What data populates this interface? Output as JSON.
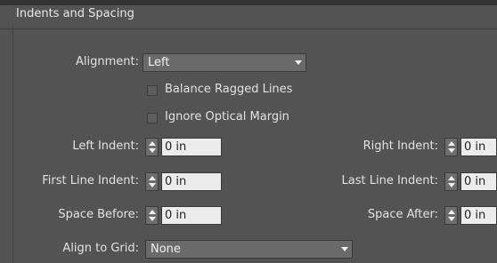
{
  "panel": {
    "title": "Indents and Spacing"
  },
  "alignment": {
    "label": "Alignment:",
    "value": "Left"
  },
  "options": {
    "balance_ragged_lines": {
      "label": "Balance Ragged Lines",
      "checked": false
    },
    "ignore_optical_margin": {
      "label": "Ignore Optical Margin",
      "checked": false
    }
  },
  "left_indent": {
    "label": "Left Indent:",
    "value": "0 in"
  },
  "right_indent": {
    "label": "Right Indent:",
    "value": "0 in"
  },
  "first_line_indent": {
    "label": "First Line Indent:",
    "value": "0 in"
  },
  "last_line_indent": {
    "label": "Last Line Indent:",
    "value": "0 in"
  },
  "space_before": {
    "label": "Space Before:",
    "value": "0 in"
  },
  "space_after": {
    "label": "Space After:",
    "value": "0 in"
  },
  "align_to_grid": {
    "label": "Align to Grid:",
    "value": "None"
  },
  "icons": {
    "dropdown": "chevron-down-icon",
    "spinner": "up-down-arrows-icon"
  },
  "colors": {
    "panel_bg": "#535353",
    "field_bg": "#ececec",
    "dropdown_bg": "#6a6a6a"
  }
}
